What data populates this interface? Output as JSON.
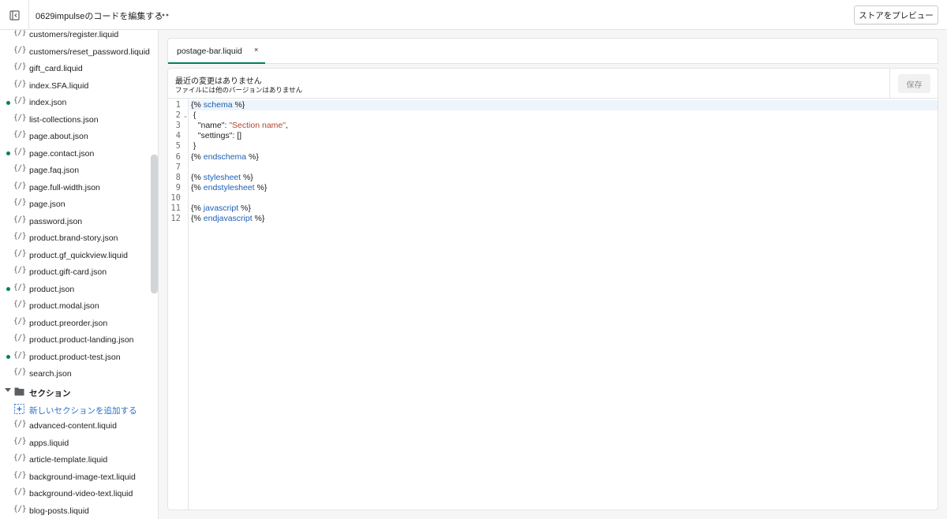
{
  "topbar": {
    "exit_icon": "exit-editor-icon",
    "title": "0629impulseのコードを編集する",
    "more_icon": "ellipsis-icon",
    "preview_label": "ストアをプレビュー"
  },
  "sidebar": {
    "files": [
      {
        "name": "customers/register.liquid",
        "dot": false
      },
      {
        "name": "customers/reset_password.liquid",
        "dot": false
      },
      {
        "name": "gift_card.liquid",
        "dot": false
      },
      {
        "name": "index.SFA.liquid",
        "dot": false
      },
      {
        "name": "index.json",
        "dot": true
      },
      {
        "name": "list-collections.json",
        "dot": false
      },
      {
        "name": "page.about.json",
        "dot": false
      },
      {
        "name": "page.contact.json",
        "dot": true
      },
      {
        "name": "page.faq.json",
        "dot": false
      },
      {
        "name": "page.full-width.json",
        "dot": false
      },
      {
        "name": "page.json",
        "dot": false
      },
      {
        "name": "password.json",
        "dot": false
      },
      {
        "name": "product.brand-story.json",
        "dot": false
      },
      {
        "name": "product.gf_quickview.liquid",
        "dot": false
      },
      {
        "name": "product.gift-card.json",
        "dot": false
      },
      {
        "name": "product.json",
        "dot": true
      },
      {
        "name": "product.modal.json",
        "dot": false
      },
      {
        "name": "product.preorder.json",
        "dot": false
      },
      {
        "name": "product.product-landing.json",
        "dot": false
      },
      {
        "name": "product.product-test.json",
        "dot": true
      },
      {
        "name": "search.json",
        "dot": false
      }
    ],
    "folder_label": "セクション",
    "add_section_label": "新しいセクションを追加する",
    "section_files": [
      "advanced-content.liquid",
      "apps.liquid",
      "article-template.liquid",
      "background-image-text.liquid",
      "background-video-text.liquid",
      "blog-posts.liquid"
    ],
    "file_icon_glyph": "{/}"
  },
  "editor": {
    "tab_label": "postage-bar.liquid",
    "tab_close": "×",
    "info_title": "最近の変更はありません",
    "info_subtitle": "ファイルには他のバージョンはありません",
    "save_label": "保存",
    "line_numbers": [
      "1",
      "2",
      "3",
      "4",
      "5",
      "6",
      "7",
      "8",
      "9",
      "10",
      "11",
      "12"
    ],
    "lines": [
      [
        {
          "t": "{% ",
          "c": ""
        },
        {
          "t": "schema",
          "c": "kw"
        },
        {
          "t": " %}",
          "c": ""
        }
      ],
      [
        {
          "t": " {",
          "c": ""
        }
      ],
      [
        {
          "t": "   \"name\": ",
          "c": ""
        },
        {
          "t": "\"Section name\"",
          "c": "str"
        },
        {
          "t": ",",
          "c": ""
        }
      ],
      [
        {
          "t": "   \"settings\": []",
          "c": ""
        }
      ],
      [
        {
          "t": " }",
          "c": ""
        }
      ],
      [
        {
          "t": "{% ",
          "c": ""
        },
        {
          "t": "endschema",
          "c": "kw"
        },
        {
          "t": " %}",
          "c": ""
        }
      ],
      [],
      [
        {
          "t": "{% ",
          "c": ""
        },
        {
          "t": "stylesheet",
          "c": "kw"
        },
        {
          "t": " %}",
          "c": ""
        }
      ],
      [
        {
          "t": "{% ",
          "c": ""
        },
        {
          "t": "endstylesheet",
          "c": "kw"
        },
        {
          "t": " %}",
          "c": ""
        }
      ],
      [],
      [
        {
          "t": "{% ",
          "c": ""
        },
        {
          "t": "javascript",
          "c": "kw"
        },
        {
          "t": " %}",
          "c": ""
        }
      ],
      [
        {
          "t": "{% ",
          "c": ""
        },
        {
          "t": "endjavascript",
          "c": "kw"
        },
        {
          "t": " %}",
          "c": ""
        }
      ]
    ]
  }
}
